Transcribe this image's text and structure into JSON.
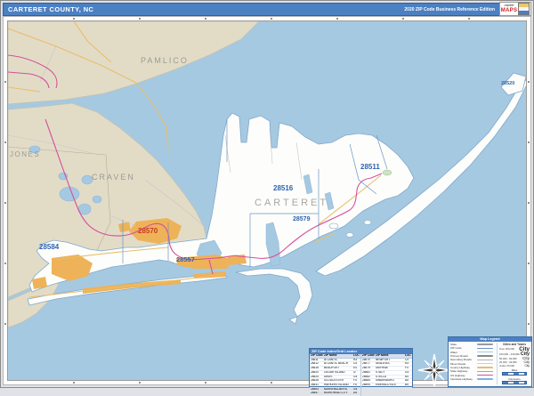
{
  "header": {
    "title": "CARTERET COUNTY, NC",
    "edition": "2020 ZIP Code Business Reference Edition",
    "logo": {
      "line1": "market",
      "line2": "MAPS"
    }
  },
  "map": {
    "county_labels": {
      "pamlico": "PAMLICO",
      "craven": "CRAVEN",
      "jones": "JONES",
      "carteret": "CARTERET"
    },
    "zip_labels": {
      "z28584": "28584",
      "z28570": "28570",
      "z28557": "28557",
      "z28516": "28516",
      "z28579": "28579",
      "z28511": "28511",
      "z28520": "28520"
    }
  },
  "zip_table": {
    "title": "ZIP Code Index/Grid Locator",
    "columns": [
      "ZIP Code",
      "ZIP Name",
      "LOC"
    ],
    "groups": [
      [
        {
          "zip": "28511",
          "name": "ATLANTIC",
          "loc": "H3"
        },
        {
          "zip": "28512",
          "name": "ATLANTIC BEACH",
          "loc": "C5"
        },
        {
          "zip": "28516",
          "name": "BEAUFORT",
          "loc": "E4"
        },
        {
          "zip": "28520",
          "name": "CEDAR ISLAND",
          "loc": "I2"
        },
        {
          "zip": "28524",
          "name": "DAVIS",
          "loc": "G4"
        },
        {
          "zip": "28528",
          "name": "GLOUCESTER",
          "loc": "F4"
        },
        {
          "zip": "28531",
          "name": "HARKERS ISLAND",
          "loc": "F5"
        },
        {
          "zip": "28553",
          "name": "MARSHALLBERG",
          "loc": "G4"
        },
        {
          "zip": "28557",
          "name": "MOREHEAD CITY",
          "loc": "D5"
        }
      ],
      [
        {
          "zip": "28570",
          "name": "NEWPORT",
          "loc": "C4"
        },
        {
          "zip": "28577",
          "name": "SEALEVEL",
          "loc": "H3"
        },
        {
          "zip": "28579",
          "name": "SMYRNA",
          "loc": "F4"
        },
        {
          "zip": "28581",
          "name": "STACY",
          "loc": "G3"
        },
        {
          "zip": "28582",
          "name": "STELLA",
          "loc": "A4"
        },
        {
          "zip": "28584",
          "name": "SWANSBORO",
          "loc": "A5"
        },
        {
          "zip": "28594",
          "name": "EMERALD ISLE",
          "loc": "B5"
        }
      ]
    ]
  },
  "legend": {
    "title": "Map Legend",
    "entries": [
      {
        "label": "State",
        "color": "#9a9a9a"
      },
      {
        "label": "ZIP Code",
        "color": "#6b96c6"
      },
      {
        "label": "Water",
        "color": "#a6c9e2"
      },
      {
        "label": "Primary Roads",
        "color": "#8a8a8a"
      },
      {
        "label": "Secondary Roads",
        "color": "#b3b3b3"
      },
      {
        "label": "Minor Roads",
        "color": "#d0d0d0"
      },
      {
        "label": "County Highway",
        "color": "#e8be6a"
      },
      {
        "label": "State Highway",
        "color": "#e98c5a"
      },
      {
        "label": "US Highway",
        "color": "#d4509c"
      },
      {
        "label": "Interstate Highway",
        "color": "#7fb2e5"
      }
    ],
    "cities": {
      "title": "Cities and Towns",
      "classes": [
        {
          "range": "Over 250,000",
          "sample": "City"
        },
        {
          "range": "100,000 - 249,999",
          "sample": "City"
        },
        {
          "range": "50,000 - 99,999",
          "sample": "City"
        },
        {
          "range": "25,000 - 49,999",
          "sample": "City"
        },
        {
          "range": "Under 25,000",
          "sample": "City"
        }
      ]
    },
    "scale": {
      "miles": "Miles",
      "kilometers": "Kilometers"
    }
  },
  "colors": {
    "header_blue": "#4b80c3",
    "water": "#a6c9e2",
    "neighbor_county_tan": "#e2dcc7",
    "county_white": "#fdfdfb",
    "urban_orange": "#eeb258",
    "us_highway_pink": "#d4509c",
    "county_road_yellow": "#e8be6a",
    "zip_boundary_blue": "#6b96c6",
    "zip_label_blue": "#2f63b0",
    "zip_label_red": "#c43c20",
    "county_label_gray": "#9b9b93"
  }
}
